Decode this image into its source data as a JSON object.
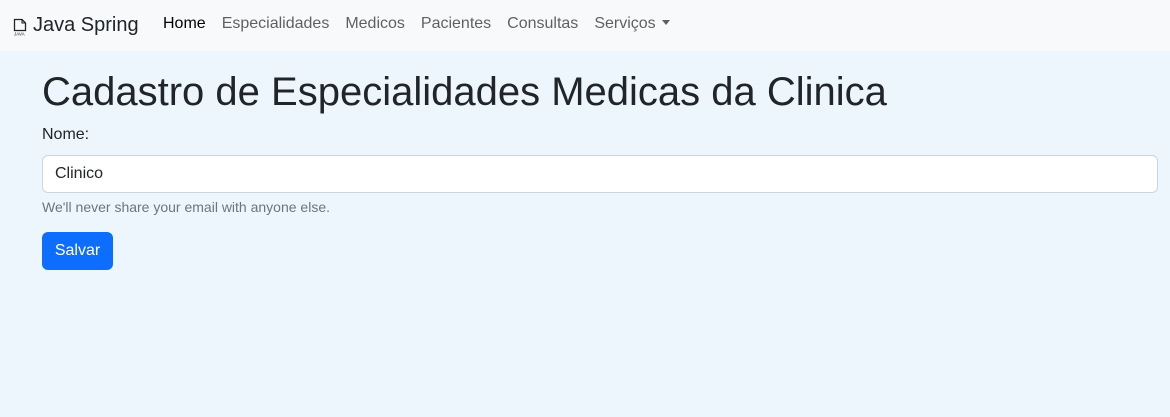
{
  "navbar": {
    "brand": "Java Spring",
    "brand_icon": "java-logo-icon",
    "items": [
      {
        "label": "Home",
        "active": true
      },
      {
        "label": "Especialidades"
      },
      {
        "label": "Medicos"
      },
      {
        "label": "Pacientes"
      },
      {
        "label": "Consultas"
      },
      {
        "label": "Serviços",
        "dropdown": true
      }
    ]
  },
  "main": {
    "title": "Cadastro de Especialidades Medicas da Clinica",
    "form": {
      "name_label": "Nome:",
      "name_value": "Clinico",
      "help_text": "We'll never share your email with anyone else.",
      "submit_label": "Salvar"
    }
  },
  "colors": {
    "primary": "#0d6efd",
    "navbar_bg": "#f8f9fa",
    "page_bg": "#eef6fd"
  }
}
